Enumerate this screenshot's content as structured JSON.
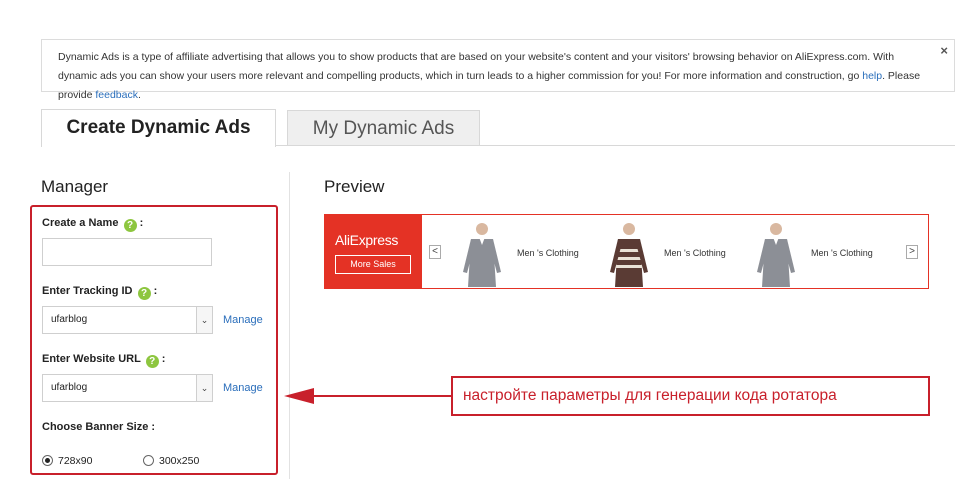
{
  "notice": {
    "text_1": "Dynamic Ads is a type of affiliate advertising that allows you to show products that are based on your website's content and your visitors' browsing behavior on AliExpress.com. With dynamic ads you can show your users more relevant and compelling products, which in turn leads to a higher commission for you! For more information and construction, go ",
    "help_link": "help",
    "text_2": ". Please provide ",
    "feedback_link": "feedback",
    "text_3": ".",
    "close": "×"
  },
  "tabs": [
    {
      "label": "Create Dynamic Ads",
      "active": true
    },
    {
      "label": "My Dynamic Ads",
      "active": false
    }
  ],
  "manager": {
    "title": "Manager",
    "name_label": "Create a Name",
    "name_value": "",
    "tracking_label": "Enter Tracking ID",
    "tracking_value": "ufarblog",
    "website_label": "Enter Website URL",
    "website_value": "ufarblog",
    "manage_label": "Manage",
    "banner_size_label": "Choose Banner Size :",
    "colon": ":",
    "sizes": [
      {
        "label": "728x90",
        "selected": true
      },
      {
        "label": "300x250",
        "selected": false
      }
    ]
  },
  "preview": {
    "title": "Preview",
    "brand": "AliExpress",
    "more_sales": "More Sales",
    "prev": "<",
    "next": ">",
    "products": [
      {
        "label": "Men 's Clothing",
        "shirt_color": "#8c8f96"
      },
      {
        "label": "Men 's Clothing",
        "shirt_color": "#5a3b34"
      },
      {
        "label": "Men 's Clothing",
        "shirt_color": "#8c8f96"
      }
    ]
  },
  "callout": {
    "text": "настройте параметры для генерации кода ротатора"
  },
  "colors": {
    "accent_red": "#c8202b",
    "ali_red": "#e43225",
    "link_blue": "#2a6ebb",
    "help_green": "#8dc63f"
  }
}
